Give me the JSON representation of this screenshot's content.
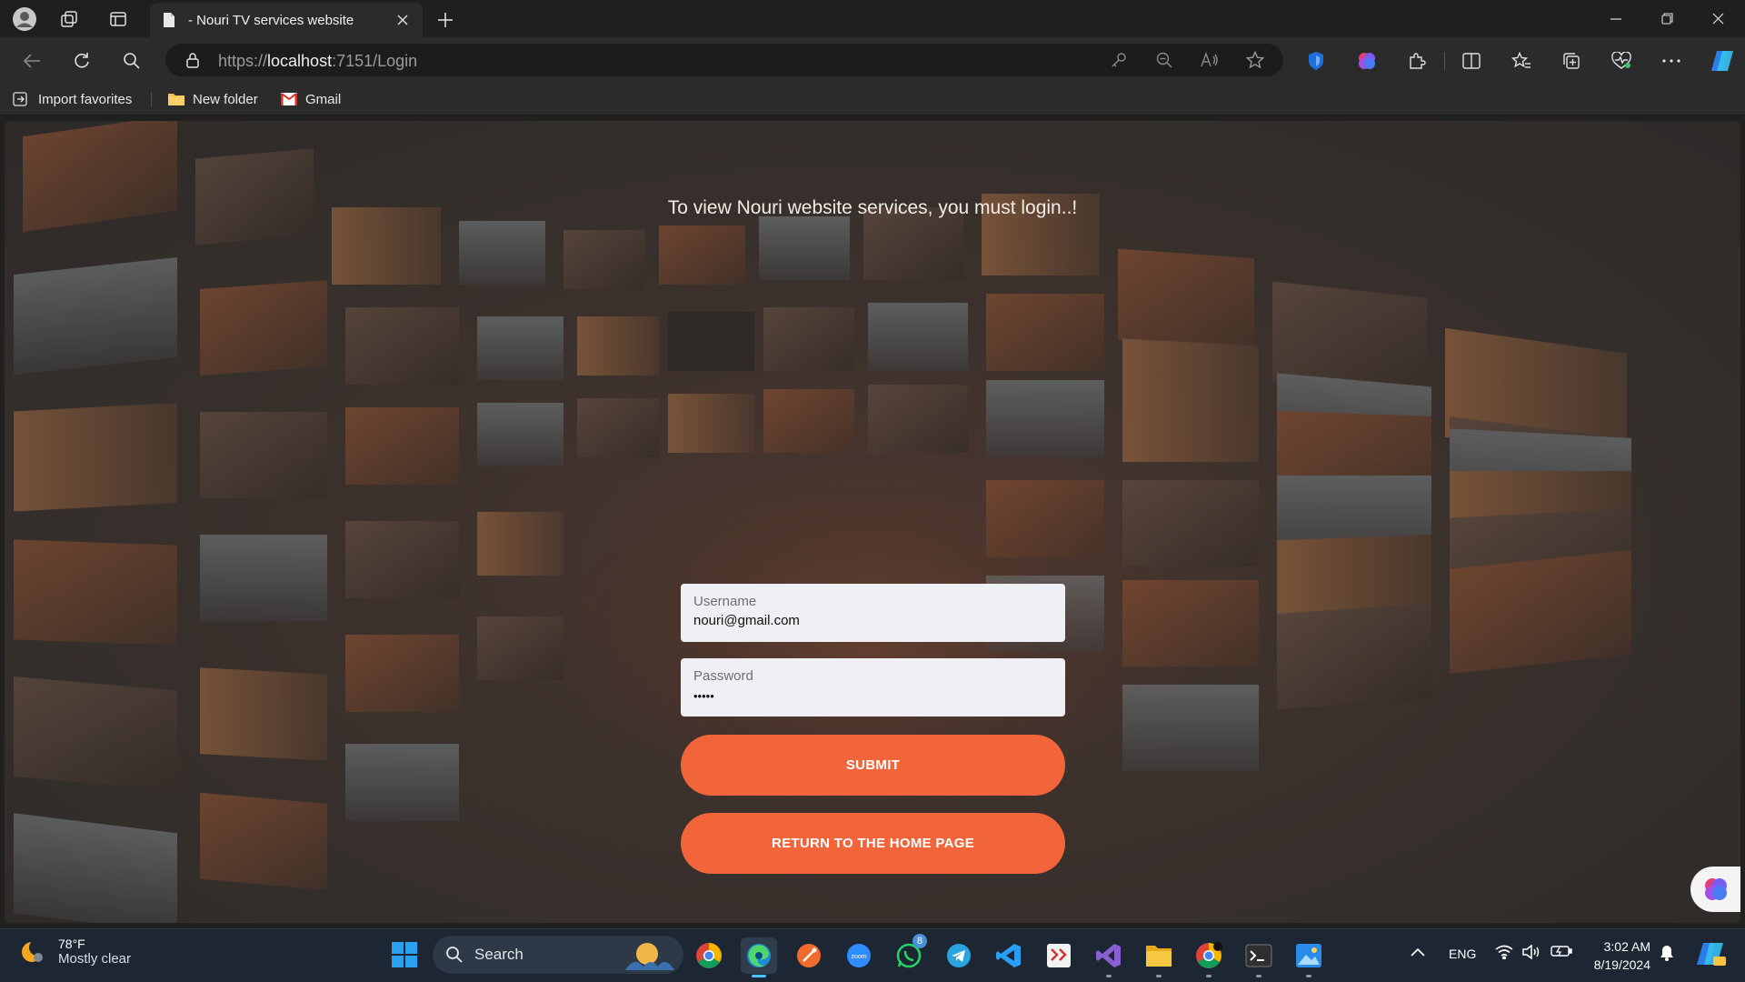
{
  "browser": {
    "tab_title": "- Nouri TV services website",
    "url_prefix": "https://",
    "url_host": "localhost",
    "url_rest": ":7151/Login",
    "bookmarks": [
      {
        "label": "Import favorites",
        "icon": "import-icon"
      },
      {
        "label": "New folder",
        "icon": "folder-icon"
      },
      {
        "label": "Gmail",
        "icon": "gmail-icon"
      }
    ]
  },
  "page": {
    "heading": "To view Nouri website services, you must login..!",
    "username": {
      "label": "Username",
      "value": "nouri@gmail.com"
    },
    "password": {
      "label": "Password",
      "masked_value": "•••••"
    },
    "submit_label": "SUBMIT",
    "home_label": "RETURN TO THE HOME PAGE",
    "accent_color": "#f2643a"
  },
  "taskbar": {
    "weather_temp": "78°F",
    "weather_condition": "Mostly clear",
    "search_label": "Search",
    "whatsapp_badge": "8",
    "language": "ENG",
    "time": "3:02 AM",
    "date": "8/19/2024"
  }
}
